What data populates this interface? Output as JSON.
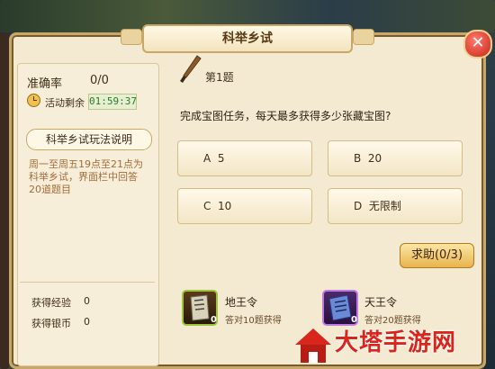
{
  "window": {
    "title": "科举乡试",
    "close_symbol": "✕"
  },
  "left_panel": {
    "accuracy_label": "准确率",
    "accuracy_value": "0/0",
    "remaining_label": "活动剩余",
    "remaining_time": "01:59:37",
    "rules_button_label": "科举乡试玩法说明",
    "rules_text": "周一至周五19点至21点为科举乡试，界面栏中回答20道题目",
    "stats": [
      {
        "label": "获得经验",
        "value": "0"
      },
      {
        "label": "获得银币",
        "value": "0"
      }
    ]
  },
  "question": {
    "number_label": "第1题",
    "text": "完成宝图任务，每天最多获得多少张藏宝图?",
    "options": [
      {
        "key": "A",
        "text": "5"
      },
      {
        "key": "B",
        "text": "20"
      },
      {
        "key": "C",
        "text": "10"
      },
      {
        "key": "D",
        "text": "无限制"
      }
    ]
  },
  "help_button_label": "求助(0/3)",
  "rewards": [
    {
      "name": "地王令",
      "desc": "答对10题获得",
      "count": "0",
      "icon": "green-scroll-token-icon"
    },
    {
      "name": "天王令",
      "desc": "答对20题获得",
      "count": "0",
      "icon": "purple-scroll-token-icon"
    }
  ],
  "watermark": {
    "text": "大塔手游网"
  }
}
